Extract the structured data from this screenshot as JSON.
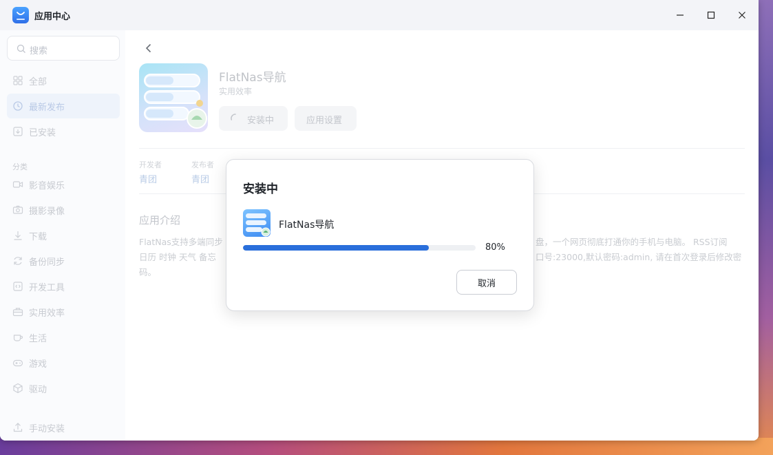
{
  "window": {
    "title": "应用中心"
  },
  "sidebar": {
    "search_placeholder": "搜索",
    "items": [
      {
        "label": "全部",
        "icon": "grid-icon"
      },
      {
        "label": "最新发布",
        "icon": "clock-icon"
      },
      {
        "label": "已安装",
        "icon": "download-box-icon"
      }
    ],
    "category_label": "分类",
    "categories": [
      {
        "label": "影音娱乐",
        "icon": "video-icon"
      },
      {
        "label": "摄影录像",
        "icon": "camera-icon"
      },
      {
        "label": "下载",
        "icon": "download-icon"
      },
      {
        "label": "备份同步",
        "icon": "sync-icon"
      },
      {
        "label": "开发工具",
        "icon": "code-icon"
      },
      {
        "label": "实用效率",
        "icon": "briefcase-icon"
      },
      {
        "label": "生活",
        "icon": "cup-icon"
      },
      {
        "label": "游戏",
        "icon": "gamepad-icon"
      },
      {
        "label": "驱动",
        "icon": "cube-icon"
      }
    ],
    "manual_install": "手动安装",
    "active_item": "最新发布"
  },
  "app": {
    "name": "FlatNas导航",
    "category": "实用效率",
    "installing_label": "安装中",
    "settings_label": "应用设置",
    "developer_key": "开发者",
    "developer_value": "青团",
    "publisher_key": "发布者",
    "publisher_value": "青团",
    "intro_title": "应用介绍",
    "intro_lines": [
      "FlatNas支持多端同步",
      "盘，一个网页彻底打通你的手机与电脑。 RSS订阅",
      "日历 时钟 天气 备忘",
      "口号:23000,默认密码:admin, 请在首次登录后修改密",
      "码。"
    ]
  },
  "dialog": {
    "title": "安装中",
    "app_name": "FlatNas导航",
    "progress": 0.8,
    "progress_label": "80%",
    "cancel_label": "取消"
  },
  "colors": {
    "accent": "#2a6fdb",
    "sidebar_bg": "#fafbfd",
    "titlebar_bg": "#f3f4f8"
  }
}
